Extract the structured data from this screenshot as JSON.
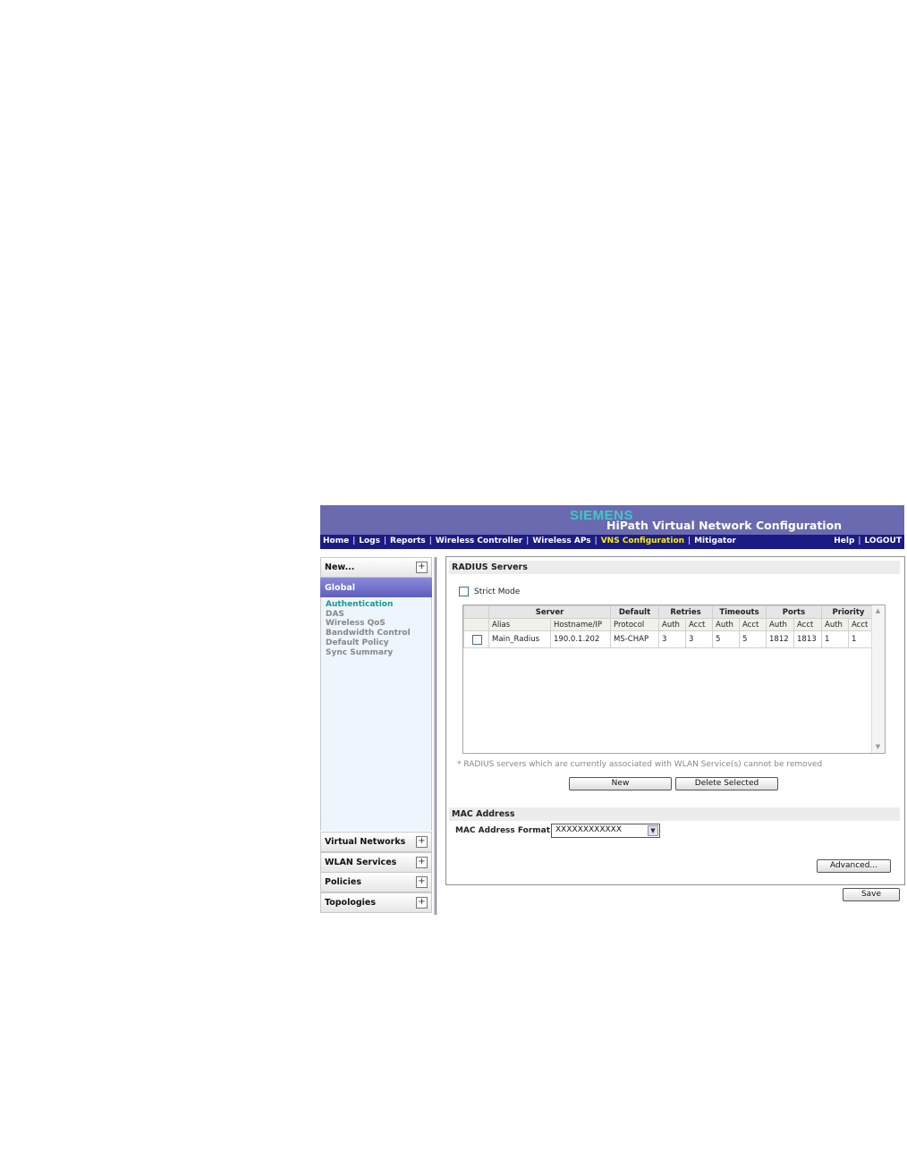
{
  "header": {
    "brand": "SIEMENS",
    "title": "HiPath Virtual Network Configuration"
  },
  "nav": {
    "left": [
      "Home",
      "Logs",
      "Reports",
      "Wireless Controller",
      "Wireless APs",
      "VNS Configuration",
      "Mitigator"
    ],
    "active": "VNS Configuration",
    "right": [
      "Help",
      "LOGOUT"
    ],
    "separator": "|"
  },
  "sidebar": {
    "new_label": "New...",
    "global_label": "Global",
    "links": [
      "Authentication",
      "DAS",
      "Wireless QoS",
      "Bandwidth Control",
      "Default Policy",
      "Sync Summary"
    ],
    "active_link": "Authentication",
    "sections": [
      "Virtual Networks",
      "WLAN Services",
      "Policies",
      "Topologies"
    ]
  },
  "radius": {
    "title": "RADIUS Servers",
    "strict_mode_label": "Strict Mode",
    "strict_mode_checked": false,
    "group_headers": [
      "Server",
      "Default",
      "Retries",
      "Timeouts",
      "Ports",
      "Priority"
    ],
    "column_headers": [
      "Alias",
      "Hostname/IP",
      "Protocol",
      "Auth",
      "Acct",
      "Auth",
      "Acct",
      "Auth",
      "Acct",
      "Auth",
      "Acct"
    ],
    "rows": [
      [
        "Main_Radius",
        "190.0.1.202",
        "MS-CHAP",
        "3",
        "3",
        "5",
        "5",
        "1812",
        "1813",
        "1",
        "1"
      ]
    ],
    "note": "* RADIUS servers which are currently associated with WLAN Service(s) cannot be removed",
    "new_button": "New",
    "delete_button": "Delete Selected"
  },
  "mac": {
    "title": "MAC Address",
    "format_label": "MAC Address Format:",
    "format_value": "XXXXXXXXXXXX",
    "advanced_button": "Advanced..."
  },
  "save_button": "Save",
  "icons": {
    "expand": "plus-box-icon",
    "dropdown": "chevron-down-icon",
    "scroll_up": "scroll-up-icon",
    "scroll_down": "scroll-down-icon"
  },
  "colors": {
    "banner": "#6a6ab0",
    "navbar": "#1b1b85",
    "active_nav": "#ffee00",
    "brand": "#40c8c8",
    "sidebar_panel": "#eef5fd",
    "active_link": "#1a9a8a"
  }
}
